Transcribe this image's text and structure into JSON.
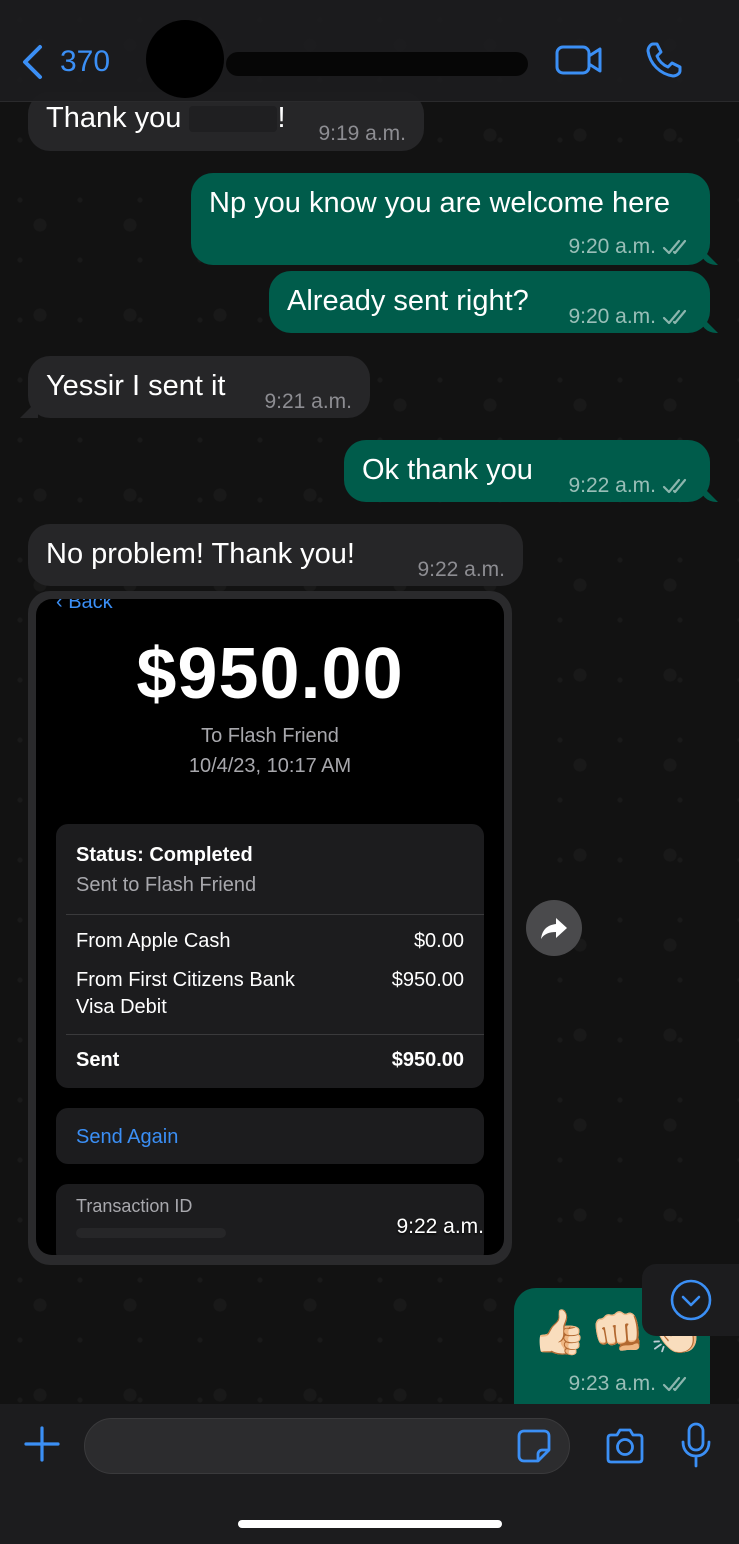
{
  "header": {
    "back_count": "370"
  },
  "messages": [
    {
      "id": "m1",
      "text_before": "Thank you",
      "text_after": "!",
      "time": "9:19 a.m."
    },
    {
      "id": "m2",
      "text": "Np you know you are welcome here",
      "time": "9:20 a.m."
    },
    {
      "id": "m3",
      "text": "Already sent right?",
      "time": "9:20 a.m."
    },
    {
      "id": "m4",
      "text": "Yessir I sent it",
      "time": "9:21 a.m."
    },
    {
      "id": "m5",
      "text": "Ok thank you",
      "time": "9:22 a.m."
    },
    {
      "id": "m6",
      "text": "No problem! Thank you!",
      "time": "9:22 a.m."
    }
  ],
  "receipt": {
    "back": "Back",
    "amount": "$950.00",
    "to": "To Flash Friend",
    "date": "10/4/23, 10:17 AM",
    "status": "Status: Completed",
    "status_sub": "Sent to Flash Friend",
    "rows": [
      {
        "label": "From Apple Cash",
        "value": "$0.00"
      },
      {
        "label": "From First Citizens Bank Visa Debit",
        "value": "$950.00"
      }
    ],
    "sent_label": "Sent",
    "sent_value": "$950.00",
    "send_again": "Send Again",
    "transaction_id": "Transaction ID",
    "time": "9:22 a.m."
  },
  "emoji_message": {
    "emojis": "👍🏻👊🏻👏🏻",
    "time": "9:23 a.m."
  },
  "composer": {
    "placeholder": ""
  },
  "colors": {
    "accent": "#3b8ff5",
    "outgoing": "#005c4b",
    "incoming": "#262628"
  }
}
